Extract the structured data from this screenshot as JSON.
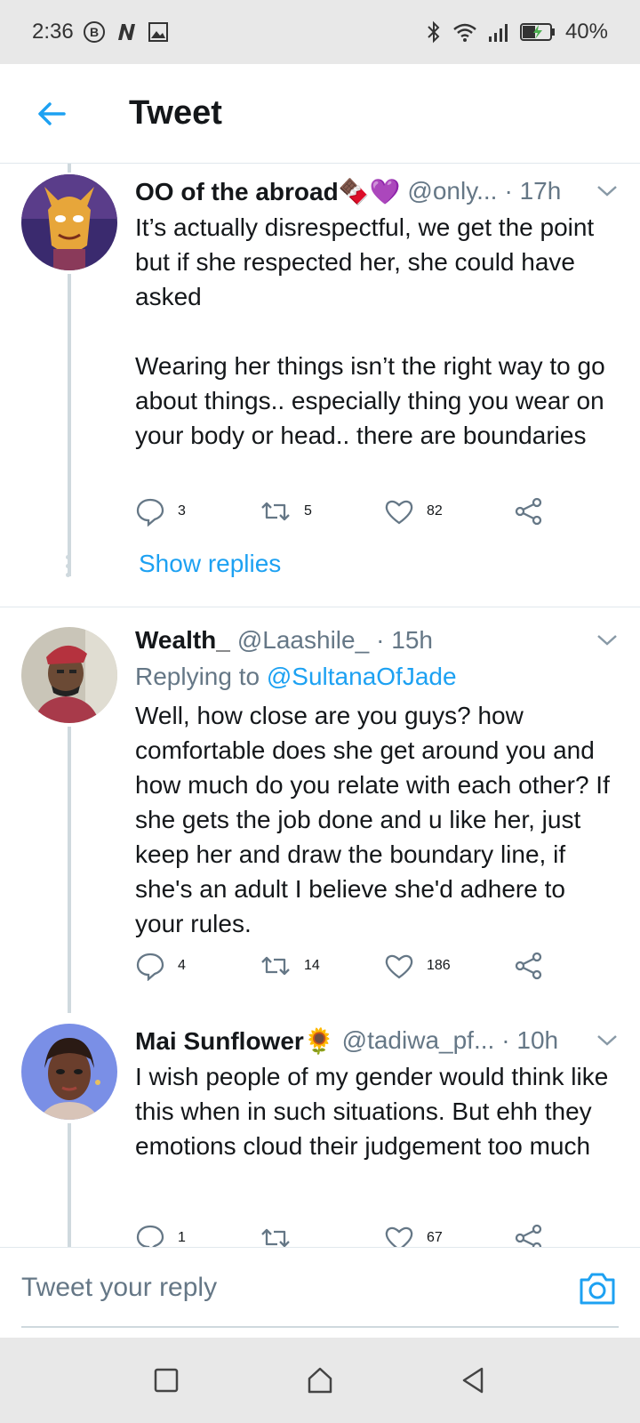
{
  "status_bar": {
    "time": "2:36",
    "battery": "40%",
    "accent": "#333333"
  },
  "header": {
    "title": "Tweet"
  },
  "tweets": [
    {
      "name": "OO of the abroad🍫💜",
      "handle": "@only...",
      "time": "· 17h",
      "replying_to_prefix": "",
      "replying_to": "",
      "body": "It’s actually disrespectful, we get the point but if she respected her, she could have asked\n\nWearing her things isn’t the right way to go about things.. especially thing you wear on your body or head.. there are boundaries",
      "replies": "3",
      "retweets": "5",
      "likes": "82",
      "show_replies": "Show replies"
    },
    {
      "name": "Wealth_",
      "handle": "@Laashile_",
      "time": "· 15h",
      "replying_to_prefix": "Replying to",
      "replying_to": "@SultanaOfJade",
      "body": "Well, how close are you guys?  how comfortable does she get around you and how much do you relate with each other? If she gets the job done and u like her, just keep her and draw the boundary line, if she's an adult I believe she'd adhere to your rules.",
      "replies": "4",
      "retweets": "14",
      "likes": "186"
    },
    {
      "name": "Mai Sunflower🌻",
      "handle": "@tadiwa_pf...",
      "time": "· 10h",
      "body": "I wish people of my gender would think like this when in such situations. But ehh they emotions cloud their judgement too much",
      "replies": "1",
      "retweets": "",
      "likes": "67"
    }
  ],
  "reply_bar": {
    "placeholder": "Tweet your reply"
  },
  "colors": {
    "brand": "#1da1f2",
    "secondary_text": "#657786"
  }
}
